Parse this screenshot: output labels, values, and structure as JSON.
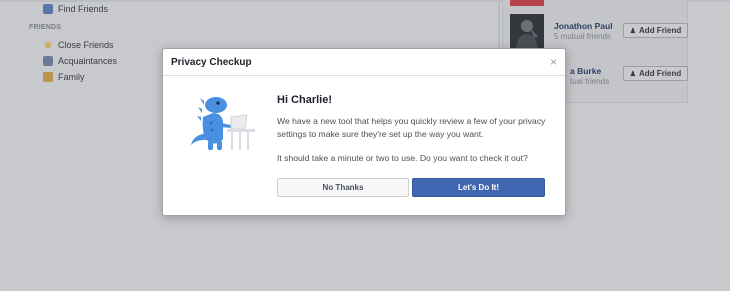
{
  "sidebar": {
    "items_top": [
      {
        "label": "Find Friends",
        "icon": "find-friends-icon"
      }
    ],
    "heading": "FRIENDS",
    "items": [
      {
        "label": "Close Friends",
        "icon": "star-icon"
      },
      {
        "label": "Acquaintances",
        "icon": "acquaintances-icon"
      },
      {
        "label": "Family",
        "icon": "family-icon"
      }
    ]
  },
  "suggestions": [
    {
      "name": "Jonathon Paul",
      "mutual": "5 mutual friends",
      "button": "Add Friend"
    },
    {
      "name": "a Burke",
      "mutual": "tual friends",
      "button": "Add Friend"
    }
  ],
  "modal": {
    "title": "Privacy Checkup",
    "close": "×",
    "greeting": "Hi Charlie!",
    "paragraph1": "We have a new tool that helps you quickly review a few of your privacy settings to make sure they're set up the way you want.",
    "paragraph2": "It should take a minute or two to use. Do you want to check it out?",
    "button_no": "No Thanks",
    "button_yes": "Let's Do It!"
  },
  "colors": {
    "accent": "#4267b2",
    "mascot": "#4a90e2"
  }
}
